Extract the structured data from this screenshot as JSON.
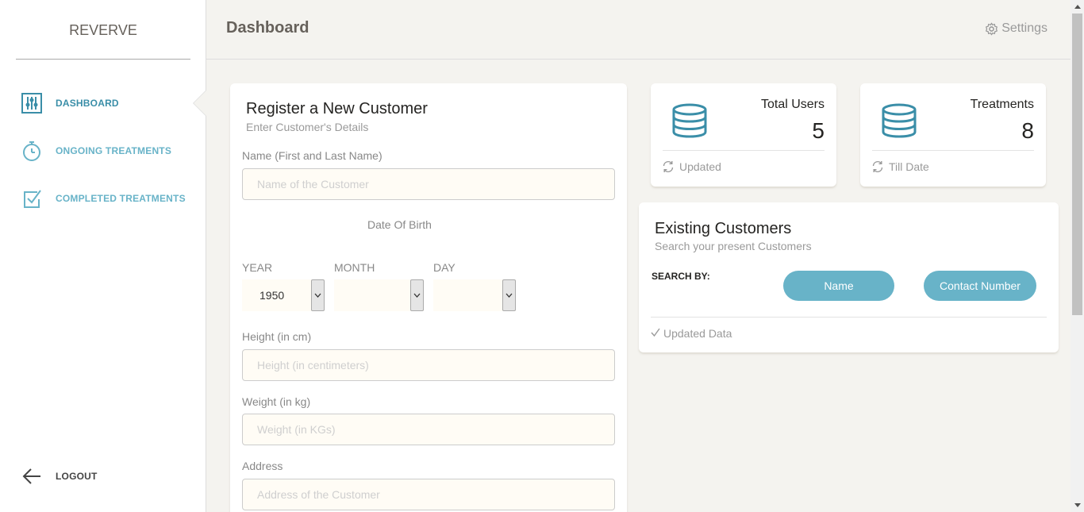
{
  "sidebar": {
    "brand": "REVERVE",
    "items": [
      {
        "label": "DASHBOARD",
        "icon": "equalizer-icon"
      },
      {
        "label": "ONGOING TREATMENTS",
        "icon": "stopwatch-icon"
      },
      {
        "label": "COMPLETED TREATMENTS",
        "icon": "checkbox-icon"
      }
    ],
    "logout": "LOGOUT"
  },
  "header": {
    "title": "Dashboard",
    "settings_label": "Settings"
  },
  "register": {
    "title": "Register a New Customer",
    "subtitle": "Enter Customer's Details",
    "name_label": "Name (First and Last Name)",
    "name_placeholder": "Name of the Customer",
    "dob_title": "Date Of Birth",
    "year_label": "YEAR",
    "year_value": "1950",
    "month_label": "MONTH",
    "month_value": "",
    "day_label": "DAY",
    "day_value": "",
    "height_label": "Height (in cm)",
    "height_placeholder": "Height (in centimeters)",
    "weight_label": "Weight (in kg)",
    "weight_placeholder": "Weight (in KGs)",
    "address_label": "Address",
    "address_placeholder": "Address of the Customer"
  },
  "stats": [
    {
      "title": "Total Users",
      "value": "5",
      "footer": "Updated"
    },
    {
      "title": "Treatments",
      "value": "8",
      "footer": "Till Date"
    }
  ],
  "customers": {
    "title": "Existing Customers",
    "subtitle": "Search your present Customers",
    "search_by": "SEARCH BY:",
    "buttons": [
      "Name",
      "Contact Number"
    ],
    "footer": "Updated Data"
  },
  "colors": {
    "accent": "#68b3c8",
    "background": "#f4f3ef",
    "input_bg": "#fffcf5"
  }
}
